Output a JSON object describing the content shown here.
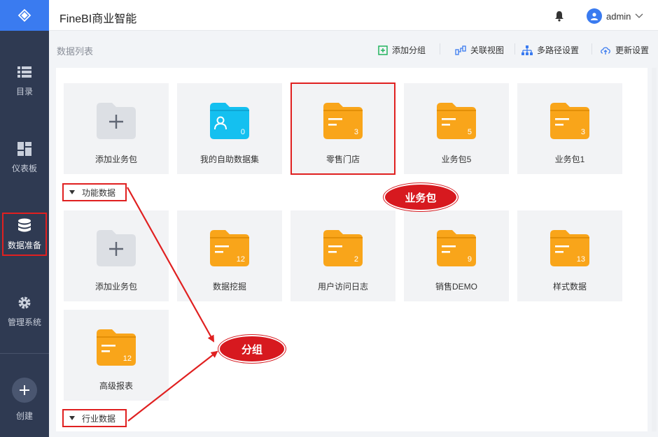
{
  "app": {
    "title": "FineBI商业智能"
  },
  "user": {
    "name": "admin"
  },
  "sidebar": {
    "items": [
      {
        "label": "目录",
        "icon": "list-icon"
      },
      {
        "label": "仪表板",
        "icon": "dashboard-icon"
      },
      {
        "label": "数据准备",
        "icon": "database-icon",
        "active": true
      },
      {
        "label": "管理系统",
        "icon": "gear-icon"
      }
    ],
    "create_label": "创建"
  },
  "toolbar": {
    "title": "数据列表",
    "add_group": "添加分组",
    "relation_view": "关联视图",
    "multi_path": "多路径设置",
    "update_settings": "更新设置"
  },
  "top_row": [
    {
      "label": "添加业务包",
      "type": "add"
    },
    {
      "label": "我的自助数据集",
      "type": "self",
      "count": "0"
    },
    {
      "label": "零售门店",
      "type": "folder",
      "count": "3"
    },
    {
      "label": "业务包5",
      "type": "folder",
      "count": "5"
    },
    {
      "label": "业务包1",
      "type": "folder",
      "count": "3"
    }
  ],
  "groups": [
    {
      "name": "功能数据",
      "cards": [
        {
          "label": "添加业务包",
          "type": "add"
        },
        {
          "label": "数据挖掘",
          "type": "folder",
          "count": "12"
        },
        {
          "label": "用户访问日志",
          "type": "folder",
          "count": "2"
        },
        {
          "label": "销售DEMO",
          "type": "folder",
          "count": "9"
        },
        {
          "label": "样式数据",
          "type": "folder",
          "count": "13"
        },
        {
          "label": "高级报表",
          "type": "folder",
          "count": "12"
        }
      ]
    },
    {
      "name": "行业数据"
    }
  ],
  "annotations": {
    "package": "业务包",
    "group": "分组"
  },
  "colors": {
    "accent": "#3a7bf0",
    "folder": "#f9a51a",
    "self_folder": "#14c0f0",
    "annotation": "#d7191f",
    "sidebar": "#2f3a52"
  }
}
